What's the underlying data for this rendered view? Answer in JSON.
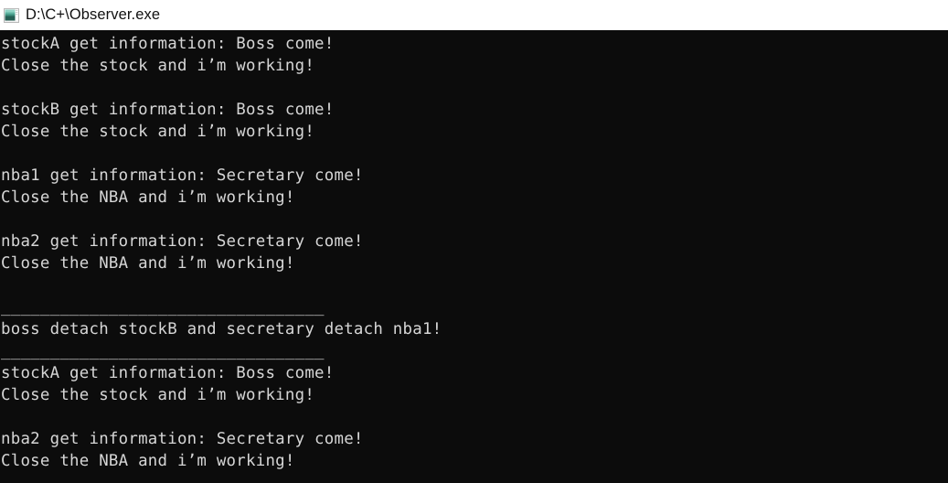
{
  "window": {
    "title": "D:\\C+\\Observer.exe",
    "icon": "console-window-icon",
    "titlebar_bg": "#ffffff",
    "titlebar_fg": "#111111",
    "console_bg": "#0c0c0c",
    "console_fg": "#d6d6d6"
  },
  "console": {
    "lines": [
      "stockA get information: Boss come!",
      "Close the stock and i’m working!",
      "",
      "stockB get information: Boss come!",
      "Close the stock and i’m working!",
      "",
      "nba1 get information: Secretary come!",
      "Close the NBA and i’m working!",
      "",
      "nba2 get information: Secretary come!",
      "Close the NBA and i’m working!",
      "",
      "_________________________________",
      "boss detach stockB and secretary detach nba1!",
      "_________________________________",
      "stockA get information: Boss come!",
      "Close the stock and i’m working!",
      "",
      "nba2 get information: Secretary come!",
      "Close the NBA and i’m working!"
    ]
  }
}
